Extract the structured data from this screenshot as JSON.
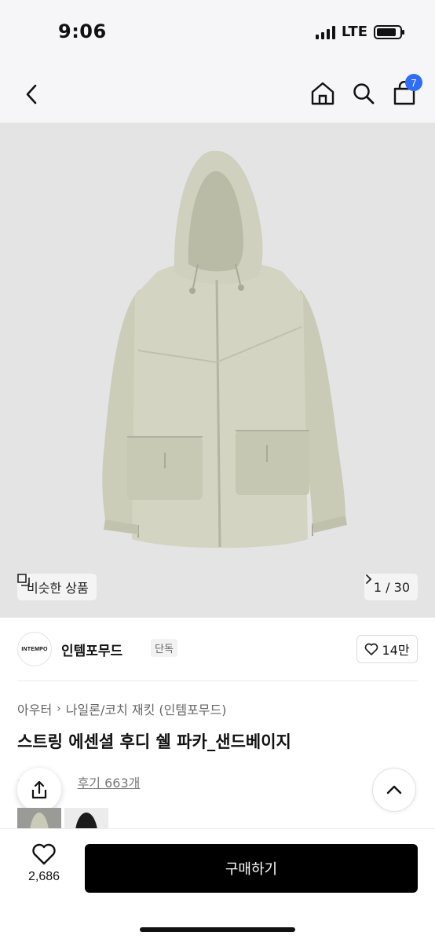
{
  "status": {
    "time": "9:06",
    "network": "LTE",
    "battery_level": 0.85
  },
  "header": {
    "back_icon": "chevron-left-icon",
    "icons": [
      "home-icon",
      "search-icon",
      "shopping-bag-icon"
    ],
    "cart_count": "7"
  },
  "hero": {
    "similar_label": "비슷한 상품",
    "page_indicator": "1 / 30"
  },
  "brand": {
    "logo_text": "INTEMPO",
    "name": "인템포무드",
    "tag": "단독",
    "likes": "14만"
  },
  "product": {
    "category": "아우터",
    "subcategory": "나일론/코치 재킷 (인템포무드)",
    "title": "스트링 에센셜 후디 쉘 파카_샌드베이지",
    "review_label": "후기 663개"
  },
  "bottom": {
    "wish_count": "2,686",
    "buy_label": "구매하기"
  },
  "colors": {
    "accent": "#2f6df6",
    "button": "#000000",
    "hero_bg": "#e4e4e4",
    "jacket": "#cfd0bd"
  }
}
